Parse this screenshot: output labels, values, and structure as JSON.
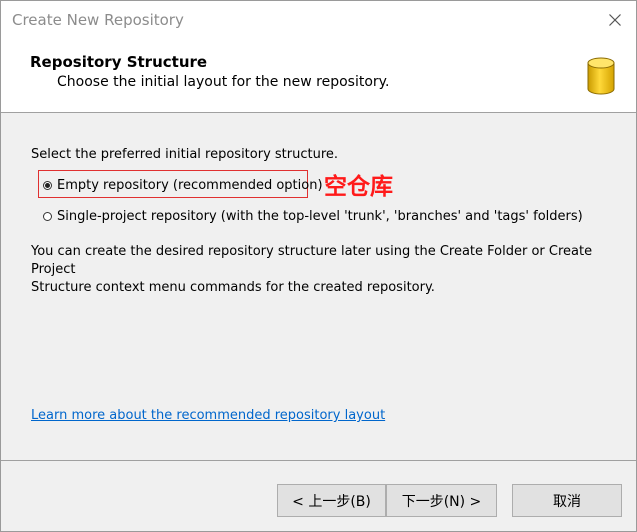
{
  "window": {
    "title": "Create New Repository"
  },
  "header": {
    "title": "Repository Structure",
    "subtitle": "Choose the initial layout for the new repository."
  },
  "content": {
    "prompt": "Select the preferred initial repository structure.",
    "options": [
      {
        "label": "Empty repository (recommended option)",
        "selected": true
      },
      {
        "label": "Single-project repository (with the top-level 'trunk', 'branches' and 'tags' folders)",
        "selected": false
      }
    ],
    "annotation": "空仓库",
    "description_line1": "You can create the desired repository structure later using the Create Folder or Create Project",
    "description_line2": "Structure context menu commands for the created repository.",
    "learn_more": "Learn more about the recommended repository layout"
  },
  "buttons": {
    "back": "< 上一步(B)",
    "next": "下一步(N) >",
    "cancel": "取消"
  },
  "colors": {
    "annotation": "#ff1a1a",
    "link": "#0066cc",
    "db_icon": "#f5c400"
  },
  "icons": {
    "close": "close-icon",
    "database": "database-icon"
  }
}
